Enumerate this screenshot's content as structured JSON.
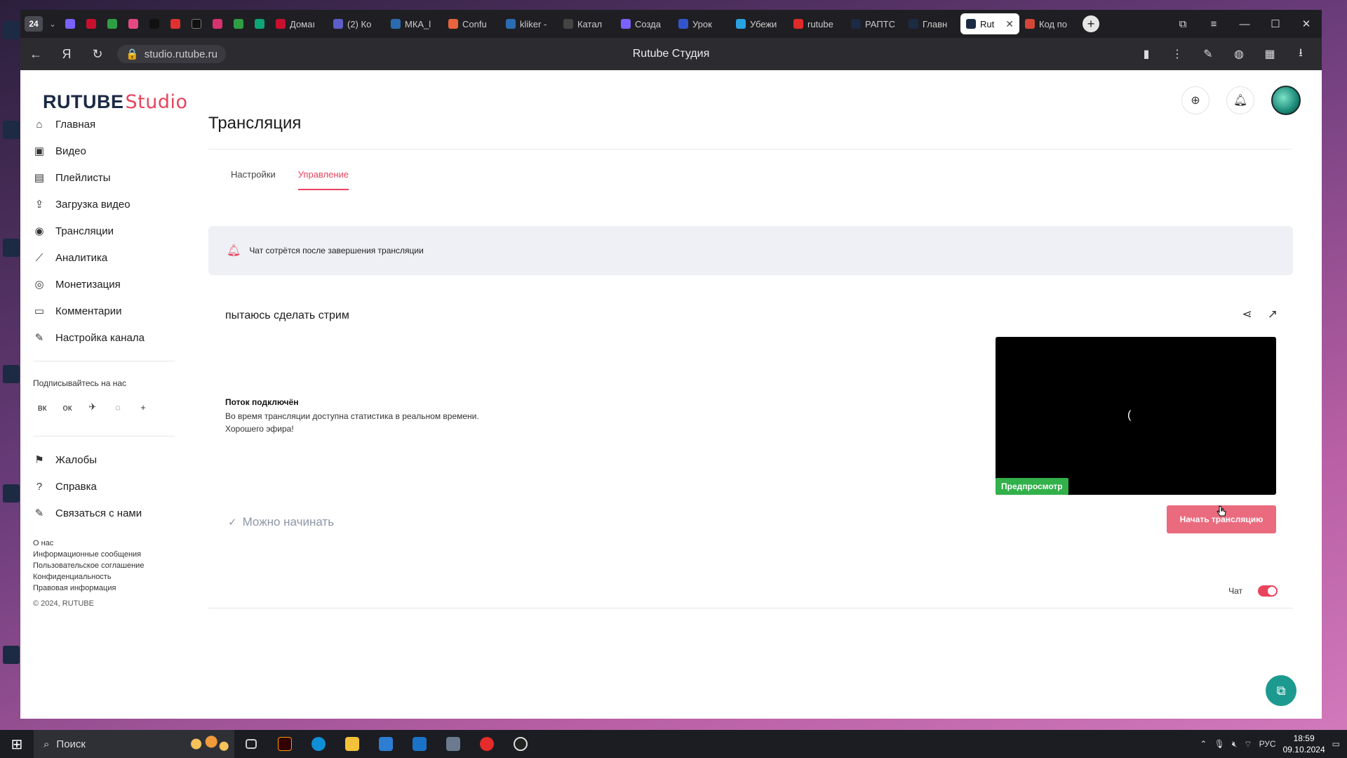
{
  "browser": {
    "tab_counter": "24",
    "tabs": [
      {
        "label": "Домаı",
        "color": "#c8102e"
      },
      {
        "label": "(2) Ко",
        "color": "#5b5fc7"
      },
      {
        "label": "МКА_l",
        "color": "#2b6cb0"
      },
      {
        "label": "Confu",
        "color": "#e8643c"
      },
      {
        "label": "kliker -",
        "color": "#2b6cb0"
      },
      {
        "label": "Катал",
        "color": "#444"
      },
      {
        "label": "Созда",
        "color": "#7b61ff"
      },
      {
        "label": "Урок",
        "color": "#3355cc"
      },
      {
        "label": "Убежи",
        "color": "#2aa3e0"
      },
      {
        "label": "rutube",
        "color": "#e02b2b"
      },
      {
        "label": "РАПТС",
        "color": "#1c2a44"
      },
      {
        "label": "Главн",
        "color": "#1c2a44"
      },
      {
        "label": "Rut",
        "color": "#1c2a44",
        "active": true
      },
      {
        "label": "Код по",
        "color": "#d44638"
      }
    ],
    "url": "studio.rutube.ru",
    "page_title": "Rutube Студия"
  },
  "header": {
    "logo_main": "RUTUBE",
    "logo_sub": "Studio"
  },
  "sidebar": {
    "items": [
      {
        "label": "Главная",
        "icon": "home-icon",
        "glyph": "⌂"
      },
      {
        "label": "Видео",
        "icon": "video-icon",
        "glyph": "▣"
      },
      {
        "label": "Плейлисты",
        "icon": "playlist-icon",
        "glyph": "▤"
      },
      {
        "label": "Загрузка видео",
        "icon": "upload-icon",
        "glyph": "⇪"
      },
      {
        "label": "Трансляции",
        "icon": "broadcast-icon",
        "glyph": "◉"
      },
      {
        "label": "Аналитика",
        "icon": "analytics-icon",
        "glyph": "⟋"
      },
      {
        "label": "Монетизация",
        "icon": "money-icon",
        "glyph": "◎"
      },
      {
        "label": "Комментарии",
        "icon": "comment-icon",
        "glyph": "▭"
      },
      {
        "label": "Настройка канала",
        "icon": "wand-icon",
        "glyph": "✎"
      }
    ],
    "subscribe_label": "Подписывайтесь на нас",
    "social": [
      "вк",
      "ок",
      "✈",
      "◌",
      "+"
    ],
    "bottom_items": [
      {
        "label": "Жалобы",
        "icon": "flag-icon",
        "glyph": "⚑"
      },
      {
        "label": "Справка",
        "icon": "help-icon",
        "glyph": "?"
      },
      {
        "label": "Связаться с нами",
        "icon": "edit-icon",
        "glyph": "✎"
      }
    ],
    "footer_links": [
      "О нас",
      "Информационные сообщения",
      "Пользовательское соглашение",
      "Конфиденциальность",
      "Правовая информация"
    ],
    "copyright": "© 2024, RUTUBE"
  },
  "main": {
    "title": "Трансляция",
    "tabs": [
      {
        "label": "Настройки",
        "active": false
      },
      {
        "label": "Управление",
        "active": true
      }
    ],
    "notice": "Чат сотрётся после завершения трансляции",
    "stream_title": "пытаюсь сделать стрим",
    "status_title": "Поток подключён",
    "status_desc_1": "Во время трансляции доступна статистика в реальном времени.",
    "status_desc_2": "Хорошего эфира!",
    "preview_badge": "Предпросмотр",
    "ready_label": "Можно начинать",
    "start_button": "Начать трансляцию",
    "chat_label": "Чат",
    "chat_enabled": true
  },
  "taskbar": {
    "search_placeholder": "Поиск",
    "lang": "РУС",
    "time": "18:59",
    "date": "09.10.2024"
  }
}
